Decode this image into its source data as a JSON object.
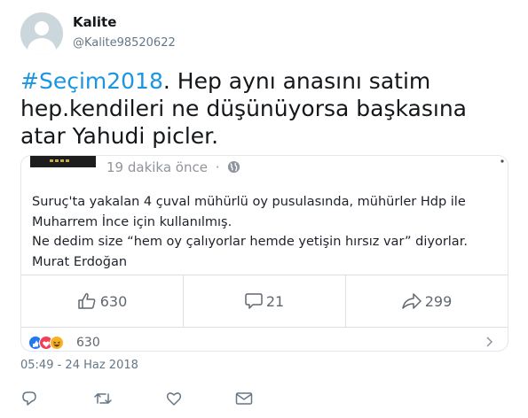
{
  "user": {
    "display_name": "Kalite",
    "handle": "@Kalite98520622",
    "avatar_icon": "default-avatar-icon"
  },
  "tweet": {
    "hashtag": "#Seçim2018",
    "text_rest": ". Hep aynı anasını satim hep.kendileri ne düşünüyorsa başkasına atar Yahudi picler.",
    "timestamp": "05:49 - 24 Haz 2018",
    "hashtag_color": "#1b95e0"
  },
  "embed": {
    "time": "19 dakika önce",
    "separator": "·",
    "globe_icon": "globe-icon",
    "more_icon": "more-dots-icon",
    "body_lines": [
      "Suruç'ta yakalan 4 çuval mühürlü oy pusulasında, mühürler Hdp ile",
      "Muharrem İnce için kullanılmış.",
      "Ne dedim size “hem oy çalıyorlar hemde yetişin hırsız var” diyorlar.",
      "Murat Erdoğan"
    ],
    "likes": "630",
    "comments": "21",
    "shares": "299",
    "reaction_count": "630",
    "reaction_icons": [
      "like-reaction-icon",
      "love-reaction-icon",
      "haha-reaction-icon"
    ]
  },
  "action_icons": [
    "reply-icon",
    "retweet-icon",
    "like-icon",
    "message-icon"
  ]
}
